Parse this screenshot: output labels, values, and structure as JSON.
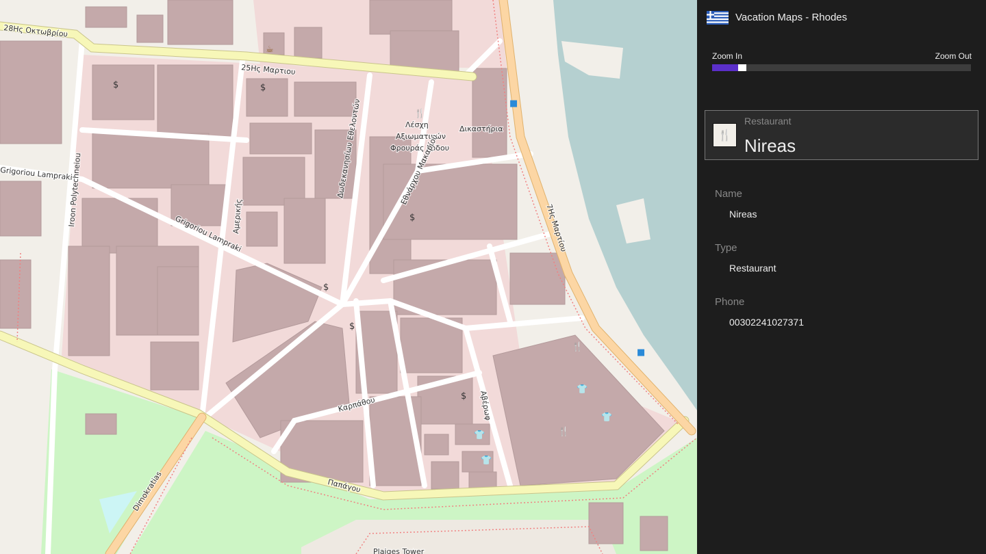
{
  "app": {
    "title": "Vacation Maps - Rhodes",
    "flag_icon": "greece-flag-icon"
  },
  "zoom": {
    "in_label": "Zoom In",
    "out_label": "Zoom Out",
    "value_percent": 10,
    "accent": "#5b2fc9"
  },
  "selected": {
    "category": "Restaurant",
    "name": "Nireas",
    "icon": "restaurant-icon"
  },
  "details": [
    {
      "label": "Name",
      "value": "Nireas"
    },
    {
      "label": "Type",
      "value": "Restaurant"
    },
    {
      "label": "Phone",
      "value": "00302241027371"
    }
  ],
  "map": {
    "labels": {
      "oktovriou": "28Ης Οκτωβρίου",
      "martiou25": "25Ης Μαρτιου",
      "lampraki_w": "Grigoriou Lampraki",
      "lampraki": "Grigoriou Lampraki",
      "polytechneiou": "Iroon Polytechneiou",
      "amerikis": "Αμερικής",
      "dodekanision": "Δωδεκανησίων Εθελοντών",
      "lesxi1": "Λέσχη",
      "lesxi2": "Αξιωματικών",
      "lesxi3": "Φρουράς Ρόδου",
      "dikastiria": "Δικαστήρια",
      "makariou": "Εθνάρχου Μακαρίου",
      "martiou7": "7Ης Μαρτίου",
      "karpathou": "Καρπάθου",
      "averof": "Αβέρωφ",
      "papagou": "Παπάγου",
      "dimokratias": "Dimokratias",
      "plaines": "Plaiges Tower"
    },
    "colors": {
      "water": "#b5d0d0",
      "residential": "#f2dad9",
      "building": "#c4a9aa",
      "park": "#cdf5c5",
      "primary": "#f7f7b8",
      "trunk": "#fcd6a4"
    }
  }
}
